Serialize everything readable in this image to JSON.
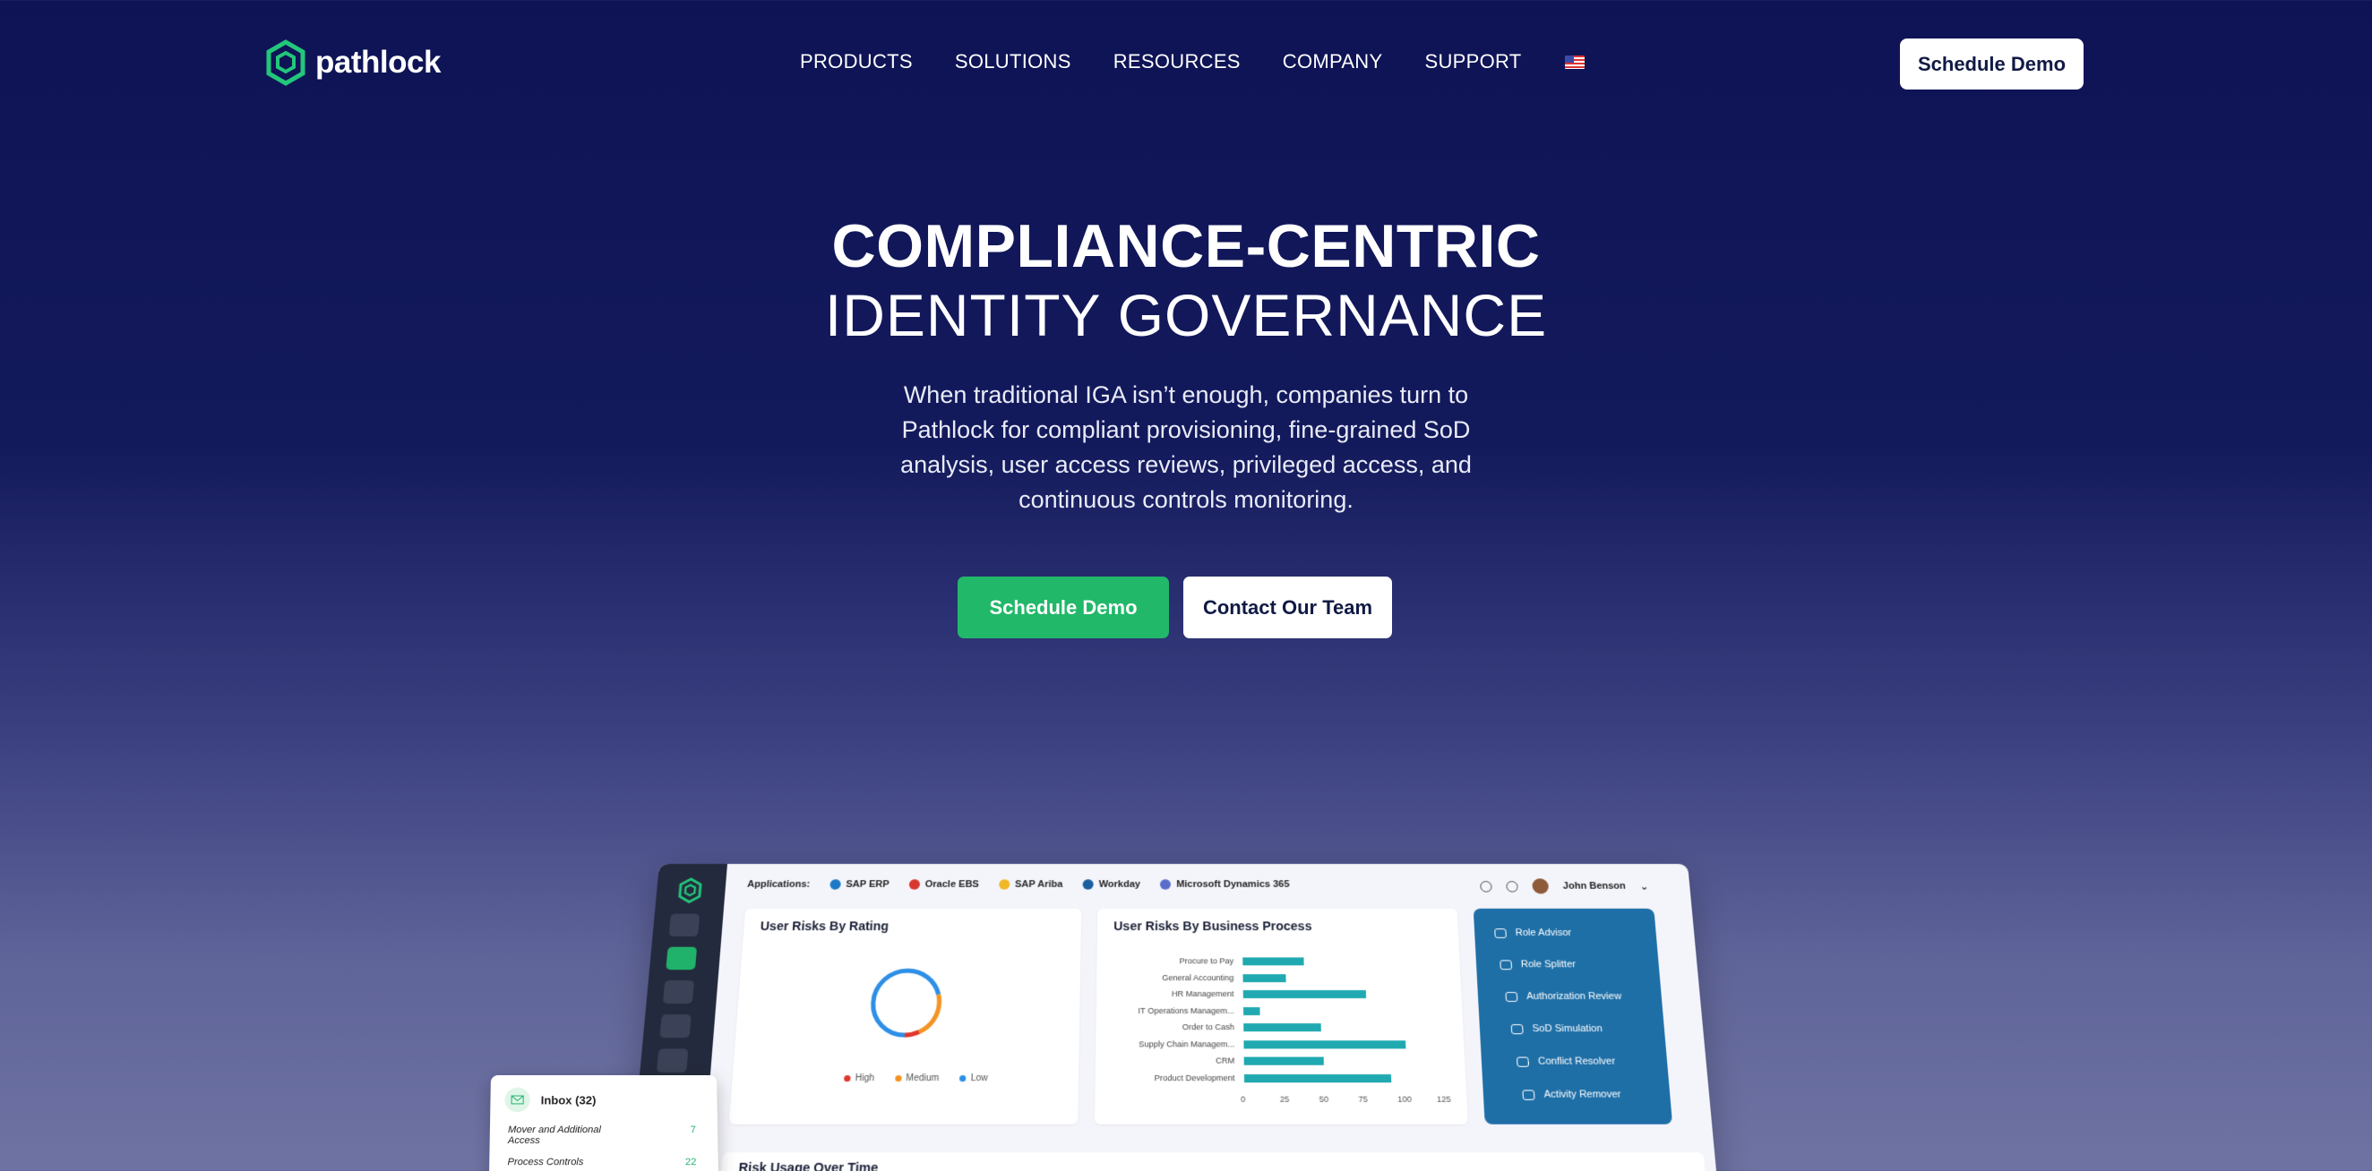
{
  "nav": {
    "logo_text": "pathlock",
    "items": [
      "PRODUCTS",
      "SOLUTIONS",
      "RESOURCES",
      "COMPANY",
      "SUPPORT"
    ],
    "locale_icon": "us-flag-icon",
    "cta": "Schedule Demo"
  },
  "hero": {
    "title": "COMPLIANCE-CENTRIC",
    "subtitle": "IDENTITY GOVERNANCE",
    "description": "When traditional IGA isn’t enough, companies turn to Pathlock for compliant provisioning, fine-grained SoD analysis, user access reviews, privileged access, and continuous controls monitoring.",
    "primary_button": "Schedule Demo",
    "secondary_button": "Contact Our Team"
  },
  "colors": {
    "brand_green": "#22b86a",
    "bg_navy": "#0e1355",
    "panel_blue": "#1f6fa7",
    "bar_teal": "#20a9b0"
  },
  "dashboard": {
    "applications_label": "Applications:",
    "applications": [
      {
        "name": "SAP ERP",
        "color": "#1f7ac6"
      },
      {
        "name": "Oracle EBS",
        "color": "#d9372e"
      },
      {
        "name": "SAP Ariba",
        "color": "#f2b824"
      },
      {
        "name": "Workday",
        "color": "#1a5fa0"
      },
      {
        "name": "Microsoft Dynamics 365",
        "color": "#5a6ec9"
      }
    ],
    "user_name": "John Benson",
    "risk_rating_card": {
      "title": "User Risks By Rating",
      "legend": [
        "High",
        "Medium",
        "Low"
      ],
      "legend_colors": [
        "#e0362d",
        "#f39422",
        "#2d8fe6"
      ]
    },
    "business_process_card": {
      "title": "User Risks By Business Process",
      "categories": [
        "Procure to Pay",
        "General Accounting",
        "HR Management",
        "IT Operations Managem...",
        "Order to Cash",
        "Supply Chain Managem...",
        "CRM",
        "Product Development"
      ],
      "values": [
        40,
        28,
        80,
        11,
        50,
        104,
        51,
        94
      ],
      "x_ticks": [
        "0",
        "25",
        "50",
        "75",
        "100",
        "125"
      ],
      "xlim": [
        0,
        125
      ]
    },
    "tools_panel": [
      "Role Advisor",
      "Role Splitter",
      "Authorization Review",
      "SoD Simulation",
      "Conflict Resolver",
      "Activity Remover"
    ],
    "risk_usage_title": "Risk Usage Over Time"
  },
  "inbox": {
    "title": "Inbox (32)",
    "rows": [
      {
        "label": "Mover and Additional Access",
        "count": "7"
      },
      {
        "label": "Process Controls",
        "count": "22"
      }
    ]
  }
}
